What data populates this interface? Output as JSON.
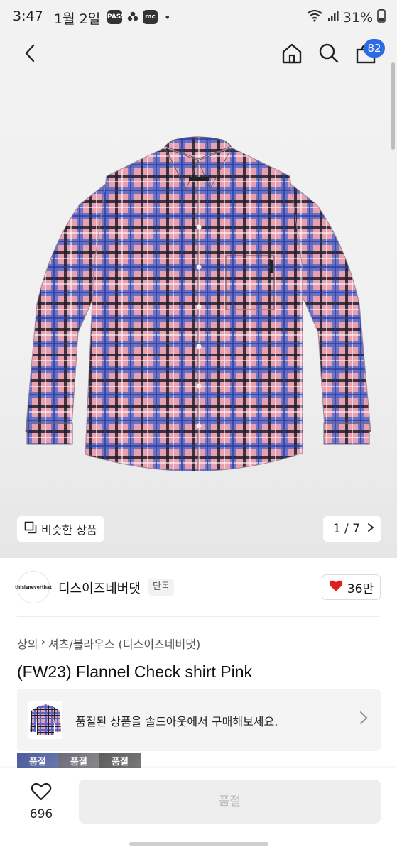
{
  "status_bar": {
    "time": "3:47",
    "date": "1월 2일",
    "badge_pass": "PASS",
    "badge_mc": "mc",
    "dot": "•",
    "battery": "31%"
  },
  "top_nav": {
    "back_icon": "chevron-left-icon",
    "home_icon": "home-icon",
    "search_icon": "search-icon",
    "cart_icon": "shopping-bag-icon",
    "cart_count": "82"
  },
  "image_gallery": {
    "similar_label": "비슷한 상품",
    "pager": "1 / 7"
  },
  "brand": {
    "logo_text": "thisisneverthat",
    "name": "디스이즈네버댓",
    "tag": "단독",
    "likes": "36만",
    "heart_color": "#e02020"
  },
  "product": {
    "breadcrumb": [
      "상의",
      "셔츠/블라우스 (디스이즈네버댓)"
    ],
    "breadcrumb_sep": "›",
    "title": "(FW23) Flannel Check shirt Pink"
  },
  "soldout_banner": {
    "text": "품절된 상품을 솔드아웃에서 구매해보세요."
  },
  "swatches": [
    {
      "label": "품절"
    },
    {
      "label": "품절"
    },
    {
      "label": "품절"
    }
  ],
  "bottom_bar": {
    "wish_count": "696",
    "buy_label": "품절"
  }
}
